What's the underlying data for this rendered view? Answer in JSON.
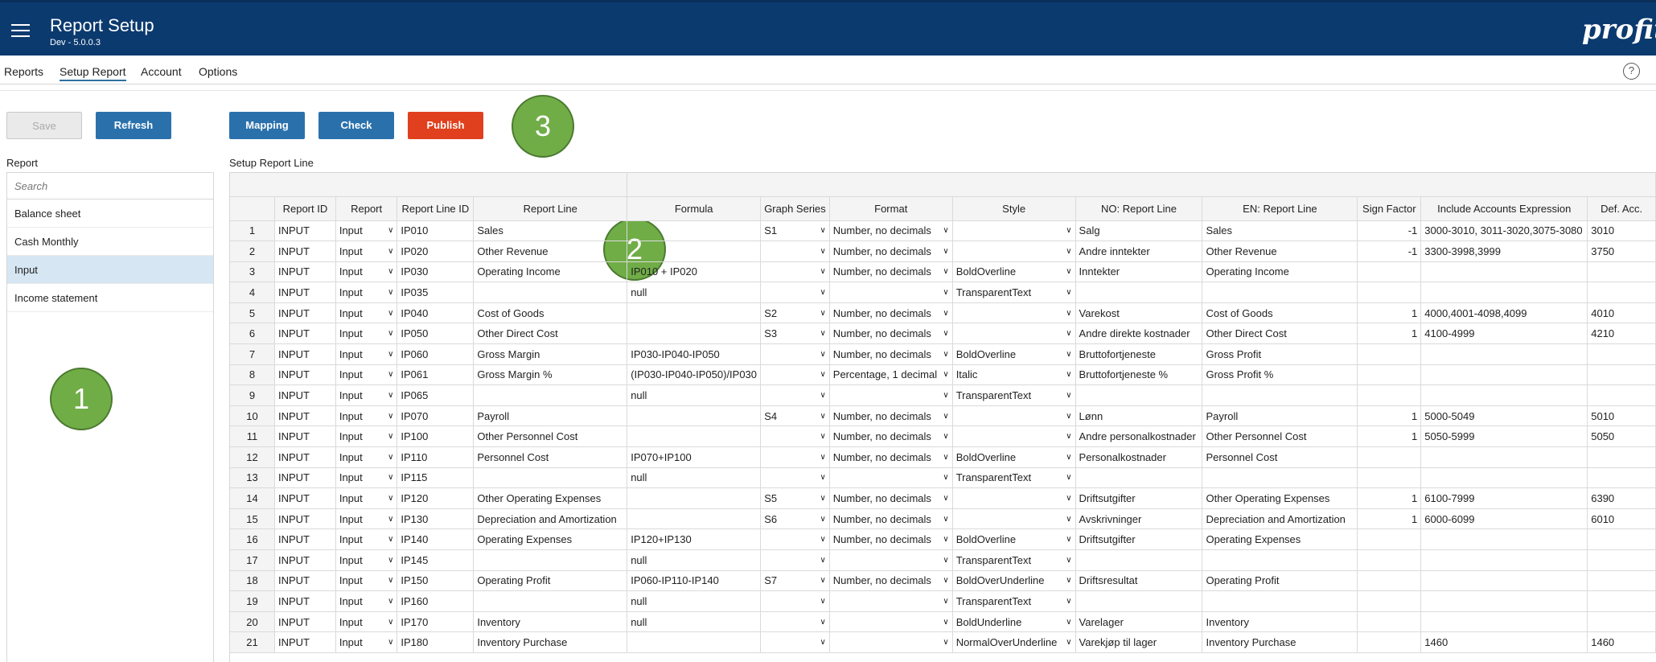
{
  "app": {
    "title": "Report Setup",
    "version": "Dev - 5.0.0.3",
    "logo": "profitbase"
  },
  "nav": {
    "items": [
      "Reports",
      "Setup Report",
      "Account",
      "Options"
    ],
    "active": "Setup Report",
    "help_label": "?"
  },
  "buttons": {
    "save": "Save",
    "refresh": "Refresh",
    "mapping": "Mapping",
    "check": "Check",
    "publish": "Publish"
  },
  "callouts": {
    "one": "1",
    "two": "2",
    "three": "3"
  },
  "left": {
    "label": "Report",
    "search_placeholder": "Search",
    "reports": [
      "Balance sheet",
      "Cash Monthly",
      "Input",
      "Income statement"
    ],
    "selected": "Input"
  },
  "grid": {
    "label": "Setup Report Line",
    "columns": [
      "Report ID",
      "Report",
      "Report Line ID",
      "Report Line",
      "Formula",
      "Graph Series",
      "Format",
      "Style",
      "NO: Report Line",
      "EN: Report Line",
      "Sign Factor",
      "Include Accounts Expression",
      "Def. Acc."
    ],
    "rows": [
      [
        "1",
        "INPUT",
        "Input",
        "IP010",
        "Sales",
        "",
        "S1",
        "Number, no decimals",
        "",
        "Salg",
        "Sales",
        "-1",
        "3000-3010, 3011-3020,3075-3080",
        "3010"
      ],
      [
        "2",
        "INPUT",
        "Input",
        "IP020",
        "Other Revenue",
        "",
        "",
        "Number, no decimals",
        "",
        "Andre inntekter",
        "Other Revenue",
        "-1",
        "3300-3998,3999",
        "3750"
      ],
      [
        "3",
        "INPUT",
        "Input",
        "IP030",
        "Operating Income",
        "IP010 + IP020",
        "",
        "Number, no decimals",
        "BoldOverline",
        "Inntekter",
        "Operating Income",
        "",
        "",
        ""
      ],
      [
        "4",
        "INPUT",
        "Input",
        "IP035",
        "",
        "null",
        "",
        "",
        "TransparentText",
        "",
        "",
        "",
        "",
        ""
      ],
      [
        "5",
        "INPUT",
        "Input",
        "IP040",
        "Cost of Goods",
        "",
        "S2",
        "Number, no decimals",
        "",
        "Varekost",
        "Cost of Goods",
        "1",
        "4000,4001-4098,4099",
        "4010"
      ],
      [
        "6",
        "INPUT",
        "Input",
        "IP050",
        "Other Direct Cost",
        "",
        "S3",
        "Number, no decimals",
        "",
        "Andre direkte kostnader",
        "Other Direct Cost",
        "1",
        "4100-4999",
        "4210"
      ],
      [
        "7",
        "INPUT",
        "Input",
        "IP060",
        "Gross Margin",
        "IP030-IP040-IP050",
        "",
        "Number, no decimals",
        "BoldOverline",
        "Bruttofortjeneste",
        "Gross Profit",
        "",
        "",
        ""
      ],
      [
        "8",
        "INPUT",
        "Input",
        "IP061",
        "Gross Margin %",
        "(IP030-IP040-IP050)/IP030",
        "",
        "Percentage, 1 decimal",
        "Italic",
        "Bruttofortjeneste %",
        "Gross Profit %",
        "",
        "",
        ""
      ],
      [
        "9",
        "INPUT",
        "Input",
        "IP065",
        "",
        "null",
        "",
        "",
        "TransparentText",
        "",
        "",
        "",
        "",
        ""
      ],
      [
        "10",
        "INPUT",
        "Input",
        "IP070",
        "Payroll",
        "",
        "S4",
        "Number, no decimals",
        "",
        "Lønn",
        "Payroll",
        "1",
        "5000-5049",
        "5010"
      ],
      [
        "11",
        "INPUT",
        "Input",
        "IP100",
        "Other Personnel Cost",
        "",
        "",
        "Number, no decimals",
        "",
        "Andre personalkostnader",
        "Other Personnel Cost",
        "1",
        "5050-5999",
        "5050"
      ],
      [
        "12",
        "INPUT",
        "Input",
        "IP110",
        "Personnel Cost",
        "IP070+IP100",
        "",
        "Number, no decimals",
        "BoldOverline",
        "Personalkostnader",
        "Personnel Cost",
        "",
        "",
        ""
      ],
      [
        "13",
        "INPUT",
        "Input",
        "IP115",
        "",
        "null",
        "",
        "",
        "TransparentText",
        "",
        "",
        "",
        "",
        ""
      ],
      [
        "14",
        "INPUT",
        "Input",
        "IP120",
        "Other Operating Expenses",
        "",
        "S5",
        "Number, no decimals",
        "",
        "Driftsutgifter",
        "Other Operating Expenses",
        "1",
        "6100-7999",
        "6390"
      ],
      [
        "15",
        "INPUT",
        "Input",
        "IP130",
        "Depreciation and Amortization",
        "",
        "S6",
        "Number, no decimals",
        "",
        "Avskrivninger",
        "Depreciation and Amortization",
        "1",
        "6000-6099",
        "6010"
      ],
      [
        "16",
        "INPUT",
        "Input",
        "IP140",
        "Operating Expenses",
        "IP120+IP130",
        "",
        "Number, no decimals",
        "BoldOverline",
        "Driftsutgifter",
        "Operating Expenses",
        "",
        "",
        ""
      ],
      [
        "17",
        "INPUT",
        "Input",
        "IP145",
        "",
        "null",
        "",
        "",
        "TransparentText",
        "",
        "",
        "",
        "",
        ""
      ],
      [
        "18",
        "INPUT",
        "Input",
        "IP150",
        "Operating Profit",
        "IP060-IP110-IP140",
        "S7",
        "Number, no decimals",
        "BoldOverUnderline",
        "Driftsresultat",
        "Operating Profit",
        "",
        "",
        ""
      ],
      [
        "19",
        "INPUT",
        "Input",
        "IP160",
        "",
        "null",
        "",
        "",
        "TransparentText",
        "",
        "",
        "",
        "",
        ""
      ],
      [
        "20",
        "INPUT",
        "Input",
        "IP170",
        "Inventory",
        "null",
        "",
        "",
        "BoldUnderline",
        "Varelager",
        "Inventory",
        "",
        "",
        ""
      ],
      [
        "21",
        "INPUT",
        "Input",
        "IP180",
        "Inventory Purchase",
        "",
        "",
        "",
        "NormalOverUnderline",
        "Varekjøp til lager",
        "Inventory Purchase",
        "",
        "1460",
        "1460"
      ]
    ]
  },
  "colors": {
    "header_bg": "#0b3a6f",
    "primary_button": "#2a71ac",
    "publish_button": "#e0401d",
    "callout": "#70ad47",
    "selected_row": "#d6e6f3"
  }
}
